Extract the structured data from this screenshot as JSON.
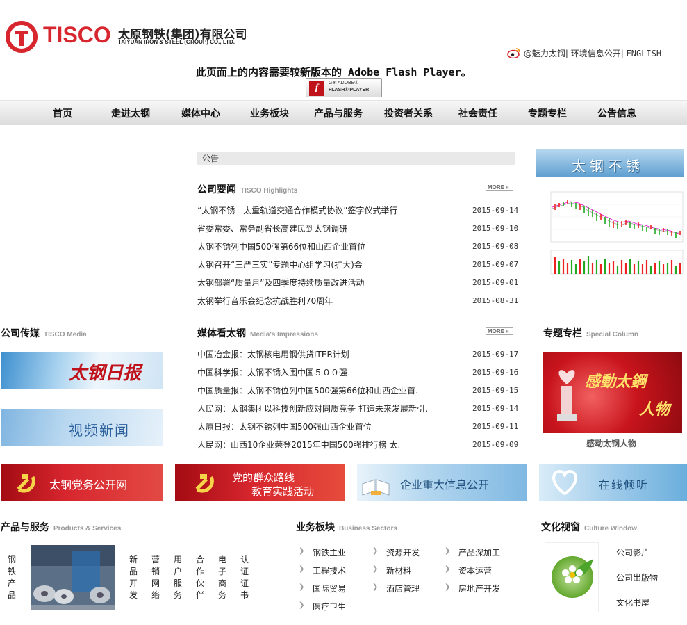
{
  "header": {
    "logo_word": "TISCO",
    "company_cn": "太原钢铁(集团)有限公司",
    "company_en": "TAIYUAN IRON & STEEL (GROUP) CO., LTD.",
    "top_links": [
      "@魅力太钢",
      "环境信息公开",
      "ENGLISH"
    ],
    "flash_message": "此页面上的内容需要较新版本的 Adobe Flash Player。",
    "flash_btn_line1": "Get ADOBE®",
    "flash_btn_line2": "FLASH® PLAYER"
  },
  "nav": [
    "首页",
    "走进太钢",
    "媒体中心",
    "业务板块",
    "产品与服务",
    "投资者关系",
    "社会责任",
    "专题专栏",
    "公告信息"
  ],
  "notice": "公告",
  "highlights": {
    "title": "公司要闻",
    "subtitle": "TISCO Highlights",
    "more": "MORE",
    "items": [
      {
        "title": "“太钢不锈—太重轨道交通合作模式协议”签字仪式举行",
        "date": "2015-09-14"
      },
      {
        "title": "省委常委、常务副省长高建民到太钢调研",
        "date": "2015-09-10"
      },
      {
        "title": "太钢不锈列中国500强第66位和山西企业首位",
        "date": "2015-09-08"
      },
      {
        "title": "太钢召开“三严三实”专题中心组学习(扩大)会",
        "date": "2015-09-07"
      },
      {
        "title": "太钢部署“质量月”及四季度持续质量改进活动",
        "date": "2015-09-01"
      },
      {
        "title": "太钢举行音乐会纪念抗战胜利70周年",
        "date": "2015-08-31"
      }
    ]
  },
  "media_impressions": {
    "title": "媒体看太钢",
    "subtitle": "Media's Impressions",
    "more": "MORE",
    "items": [
      {
        "title": "中国冶金报：太钢核电用钢供货ITER计划",
        "date": "2015-09-17"
      },
      {
        "title": "中国科学报：太钢不锈入围中国５００强",
        "date": "2015-09-16"
      },
      {
        "title": "中国质量报：太钢不锈位列中国500强第66位和山西企业首.",
        "date": "2015-09-15"
      },
      {
        "title": "人民网：太钢集团以科技创新应对同质竞争 打造未来发展新引.",
        "date": "2015-09-14"
      },
      {
        "title": "太原日报：太钢不锈列中国500强山西企业首位",
        "date": "2015-09-11"
      },
      {
        "title": "人民网：山西10企业荣登2015年中国500强排行榜 太.",
        "date": "2015-09-09"
      }
    ]
  },
  "company_media": {
    "title": "公司传媒",
    "subtitle": "TISCO Media",
    "banner1": "太钢日报",
    "banner2": "视频新闻"
  },
  "stock": {
    "banner": "太钢不锈"
  },
  "special_column": {
    "title": "专题专栏",
    "subtitle": "Special Column",
    "image_text_1": "感動太鋼",
    "image_text_2": "人物",
    "caption": "感动太钢人物"
  },
  "banners": {
    "party": "太钢党务公开网",
    "mass_line_1": "党的群众路线",
    "mass_line_2": "教育实践活动",
    "disclosure": "企业重大信息公开",
    "listen": "在线倾听"
  },
  "products": {
    "title": "产品与服务",
    "subtitle": "Products & Services",
    "left_vertical": "钢铁产品",
    "columns": [
      "新品开发",
      "营销网络",
      "用户服务",
      "合作伙伴",
      "电子商务",
      "认证证书"
    ]
  },
  "business": {
    "title": "业务板块",
    "subtitle": "Business Sectors",
    "col1": [
      "钢铁主业",
      "工程技术",
      "国际贸易",
      "医疗卫生"
    ],
    "col2": [
      "资源开发",
      "新材料",
      "酒店管理"
    ],
    "col3": [
      "产品深加工",
      "资本运营",
      "房地产开发"
    ]
  },
  "culture": {
    "title": "文化视窗",
    "subtitle": "Culture Window",
    "items": [
      "公司影片",
      "公司出版物",
      "文化书屋"
    ]
  },
  "colors": {
    "brand_red": "#d7262e",
    "banner_blue": "#5a9fd4",
    "banner_red": "#c8141c"
  }
}
